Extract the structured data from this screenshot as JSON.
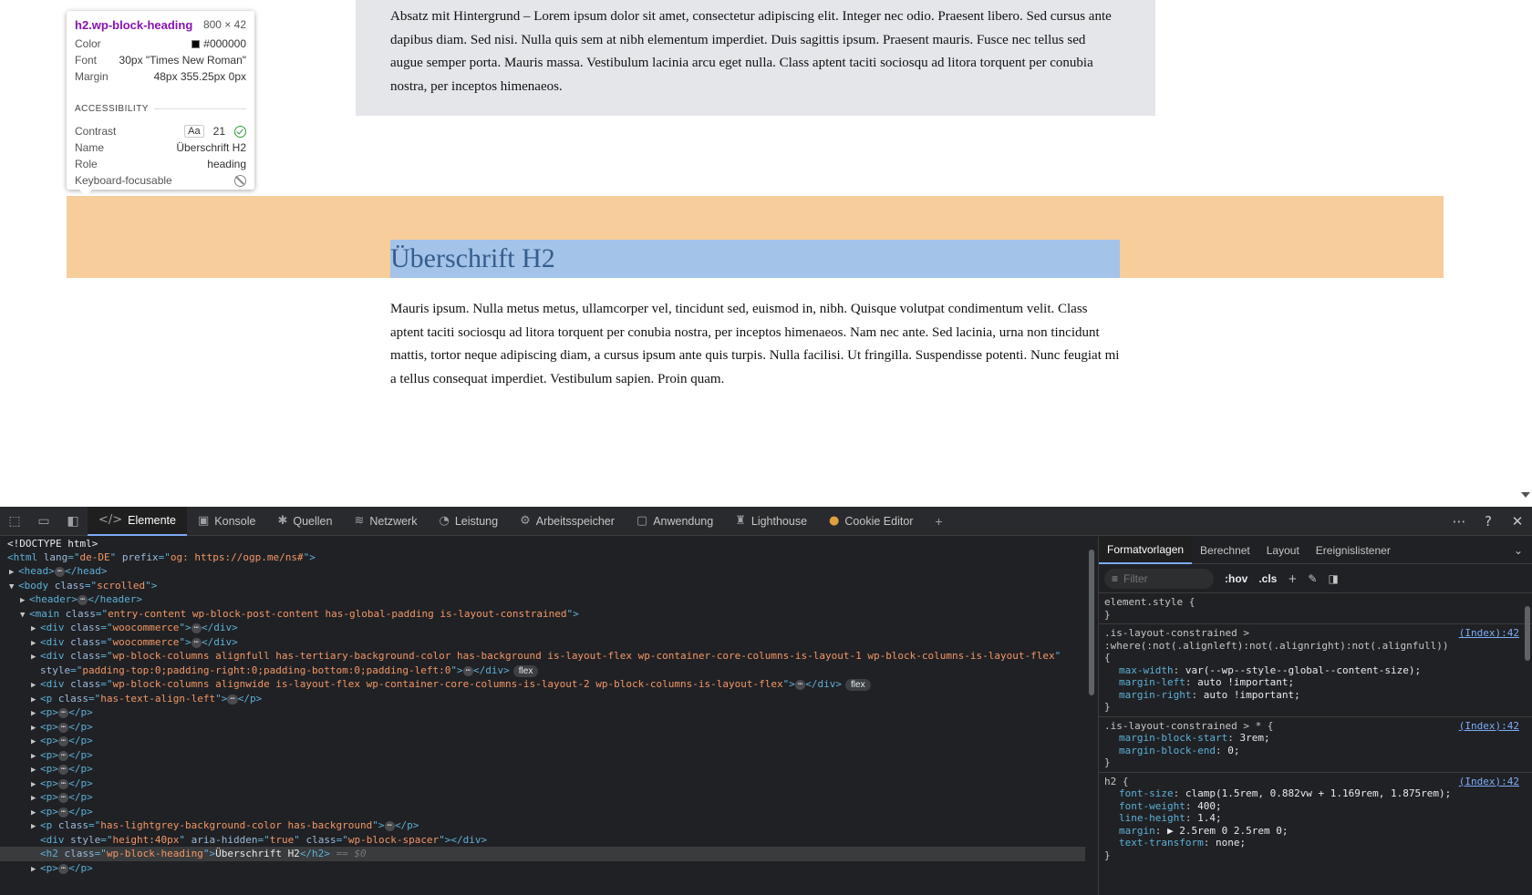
{
  "page": {
    "para_bg_text": "Absatz mit Hintergrund – Lorem ipsum dolor sit amet, consectetur adipiscing elit. Integer nec odio. Praesent libero. Sed cursus ante dapibus diam. Sed nisi. Nulla quis sem at nibh elementum imperdiet. Duis sagittis ipsum. Praesent mauris. Fusce nec tellus sed augue semper porta. Mauris massa. Vestibulum lacinia arcu eget nulla. Class aptent taciti sociosqu ad litora torquent per conubia nostra, per inceptos himenaeos.",
    "heading": "Überschrift H2",
    "body_text": "Mauris ipsum. Nulla metus metus, ullamcorper vel, tincidunt sed, euismod in, nibh. Quisque volutpat condimentum velit. Class aptent taciti sociosqu ad litora torquent per conubia nostra, per inceptos himenaeos. Nam nec ante. Sed lacinia, urna non tincidunt mattis, tortor neque adipiscing diam, a cursus ipsum ante quis turpis. Nulla facilisi. Ut fringilla. Suspendisse potenti. Nunc feugiat mi a tellus consequat imperdiet. Vestibulum sapien. Proin quam."
  },
  "tooltip": {
    "selector": "h2.wp-block-heading",
    "dimensions": "800 × 42",
    "color_label": "Color",
    "color_value": "#000000",
    "font_label": "Font",
    "font_value": "30px \"Times New Roman\"",
    "margin_label": "Margin",
    "margin_value": "48px 355.25px 0px",
    "section": "ACCESSIBILITY",
    "contrast_label": "Contrast",
    "contrast_aa": "Aa",
    "contrast_value": "21",
    "name_label": "Name",
    "name_value": "Überschrift H2",
    "role_label": "Role",
    "role_value": "heading",
    "keyboard_label": "Keyboard-focusable"
  },
  "devtools": {
    "tabs": [
      {
        "label": "Elemente",
        "icon": "</>"
      },
      {
        "label": "Konsole",
        "icon": "▣"
      },
      {
        "label": "Quellen",
        "icon": "✱"
      },
      {
        "label": "Netzwerk",
        "icon": "≋"
      },
      {
        "label": "Leistung",
        "icon": "◔"
      },
      {
        "label": "Arbeitsspeicher",
        "icon": "⚙"
      },
      {
        "label": "Anwendung",
        "icon": "▢"
      },
      {
        "label": "Lighthouse",
        "icon": "♜"
      },
      {
        "label": "Cookie Editor",
        "icon": "●"
      }
    ],
    "add_tab": "+",
    "more": "⋯",
    "help": "?",
    "close": "✕"
  },
  "dom": {
    "doctype": "<!DOCTYPE html>",
    "html_lang": "de-DE",
    "html_prefix": "og: https://ogp.me/ns#",
    "body_class": "scrolled",
    "main_class": "entry-content wp-block-post-content has-global-padding is-layout-constrained",
    "wc_class": "woocommerce",
    "cols1_class": "wp-block-columns alignfull has-tertiary-background-color has-background is-layout-flex wp-container-core-columns-is-layout-1 wp-block-columns-is-layout-flex",
    "cols1_style": "padding-top:0;padding-right:0;padding-bottom:0;padding-left:0",
    "cols2_class": "wp-block-columns alignwide is-layout-flex wp-container-core-columns-is-layout-2 wp-block-columns-is-layout-flex",
    "p_left_class": "has-text-align-left",
    "p_grey_class": "has-lightgrey-background-color has-background",
    "spacer_style": "height:40px",
    "spacer_aria": "true",
    "spacer_class": "wp-block-spacer",
    "h2_class": "wp-block-heading",
    "h2_text": "Überschrift H2",
    "selected_marker": "== $0",
    "flex_badge": "flex"
  },
  "styles": {
    "tabs": [
      "Formatvorlagen",
      "Berechnet",
      "Layout",
      "Ereignislistener"
    ],
    "filter_placeholder": "Filter",
    "hov": ":hov",
    "cls": ".cls",
    "element_style": "element.style {",
    "source": "(Index):42",
    "rule1_selector_a": ".is-layout-constrained >",
    "rule1_selector_b": ":where(:not(.alignleft):not(.alignright):not(.alignfull))",
    "rule1_decls": [
      {
        "p": "max-width",
        "v": "var(--wp--style--global--content-size);"
      },
      {
        "p": "margin-left",
        "v": "auto !important;"
      },
      {
        "p": "margin-right",
        "v": "auto !important;"
      }
    ],
    "rule2_selector": ".is-layout-constrained > * {",
    "rule2_decls": [
      {
        "p": "margin-block-start",
        "v": "3rem;"
      },
      {
        "p": "margin-block-end",
        "v": "0;"
      }
    ],
    "rule3_selector": "h2 {",
    "rule3_decls": [
      {
        "p": "font-size",
        "v": "clamp(1.5rem, 0.882vw + 1.169rem, 1.875rem);"
      },
      {
        "p": "font-weight",
        "v": "400;"
      },
      {
        "p": "line-height",
        "v": "1.4;"
      },
      {
        "p": "margin",
        "v": "▶ 2.5rem 0 2.5rem 0;"
      },
      {
        "p": "text-transform",
        "v": "none;"
      }
    ]
  }
}
